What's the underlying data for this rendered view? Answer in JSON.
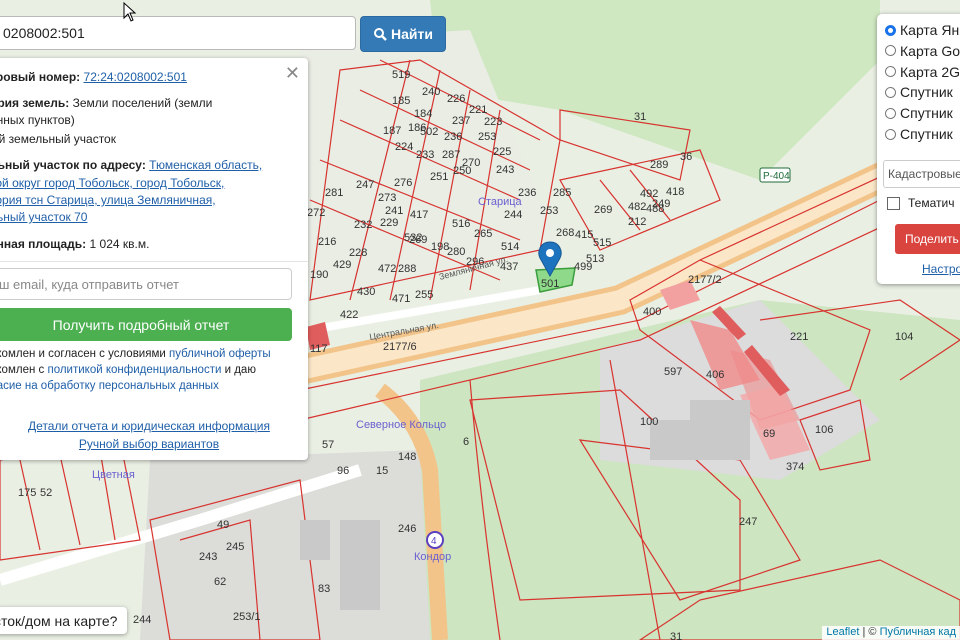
{
  "search": {
    "value": "0208002:501",
    "button_label": "Найти"
  },
  "info": {
    "cad_label": "тровый номер:",
    "cad_value": "72:24:0208002:501",
    "cat_label": "ория земель:",
    "cat_value_1": "Земли поселений (земли",
    "cat_value_2": "енных пунктов)",
    "type_line": "ый земельный участок",
    "addr_label": "льный участок по адресу:",
    "addr_1": "Тюменская область,",
    "addr_2": "кой округ город Тобольск, город Тобольск,",
    "addr_3": "тория тсн Старица, улица Земляничная,",
    "addr_4": "льный участок 70",
    "area_label": "енная площадь:",
    "area_value": "1 024 кв.м.",
    "email_placeholder": "ш email, куда отправить отчет",
    "report_button": "Получить подробный отчет",
    "agree_1a": "акомлен и согласен с условиями",
    "agree_1b": "публичной оферты",
    "agree_2a": "акомлен с",
    "agree_2b": "политикой конфиденциальности",
    "agree_2c": "и даю",
    "agree_3": "ласие на обработку персональных данных",
    "details_link": "Детали отчета и юридическая информация",
    "manual_link": "Ручной выбор вариантов"
  },
  "layers": {
    "options": [
      "Карта Ян",
      "Карта Go",
      "Карта 2G",
      "Спутник",
      "Спутник",
      "Спутник"
    ],
    "selected_index": 0,
    "kadastr": "Кадастровые",
    "thematic": "Тематич",
    "share": "Поделить",
    "settings": "Настро"
  },
  "bottom_button": "сток/дом на карте?",
  "attribution": {
    "leaflet": "Leaflet",
    "sep": "| ©",
    "public": "Публичная кад"
  },
  "map": {
    "selected_plot": "501",
    "road_label": "Р-404",
    "labels": [
      "519",
      "185",
      "240",
      "226",
      "184",
      "186",
      "221",
      "237",
      "223",
      "187",
      "502",
      "236",
      "253",
      "224",
      "233",
      "287",
      "225",
      "270",
      "31",
      "276",
      "251",
      "250",
      "243",
      "236",
      "289",
      "36",
      "247",
      "281",
      "273",
      "253",
      "285",
      "417",
      "269",
      "482",
      "415",
      "249",
      "241",
      "244",
      "492",
      "515",
      "488",
      "418",
      "272",
      "232",
      "229",
      "269",
      "268",
      "280",
      "516",
      "265",
      "212",
      "216",
      "228",
      "532",
      "198",
      "190",
      "429",
      "472",
      "288",
      "296",
      "514",
      "513",
      "499",
      "437",
      "430",
      "471",
      "255",
      "422",
      "117",
      "221",
      "104",
      "597",
      "406",
      "69",
      "106",
      "374",
      "247",
      "100",
      "96",
      "15",
      "148",
      "175",
      "52",
      "57",
      "83",
      "49",
      "245",
      "243",
      "62",
      "246",
      "244",
      "253/1",
      "31",
      "400",
      "2177/2",
      "2177/6",
      "6"
    ],
    "place_labels": [
      "Старица",
      "Северное Кольцо",
      "Кондор",
      "Цветная"
    ],
    "street_labels": [
      "Центральная ул.",
      "Земляничная ул."
    ]
  },
  "colors": {
    "primary_blue": "#337ab7",
    "green": "#4caf50",
    "red": "#d9443f",
    "plot_stroke": "#d8332f",
    "marker": "#1e73be"
  }
}
